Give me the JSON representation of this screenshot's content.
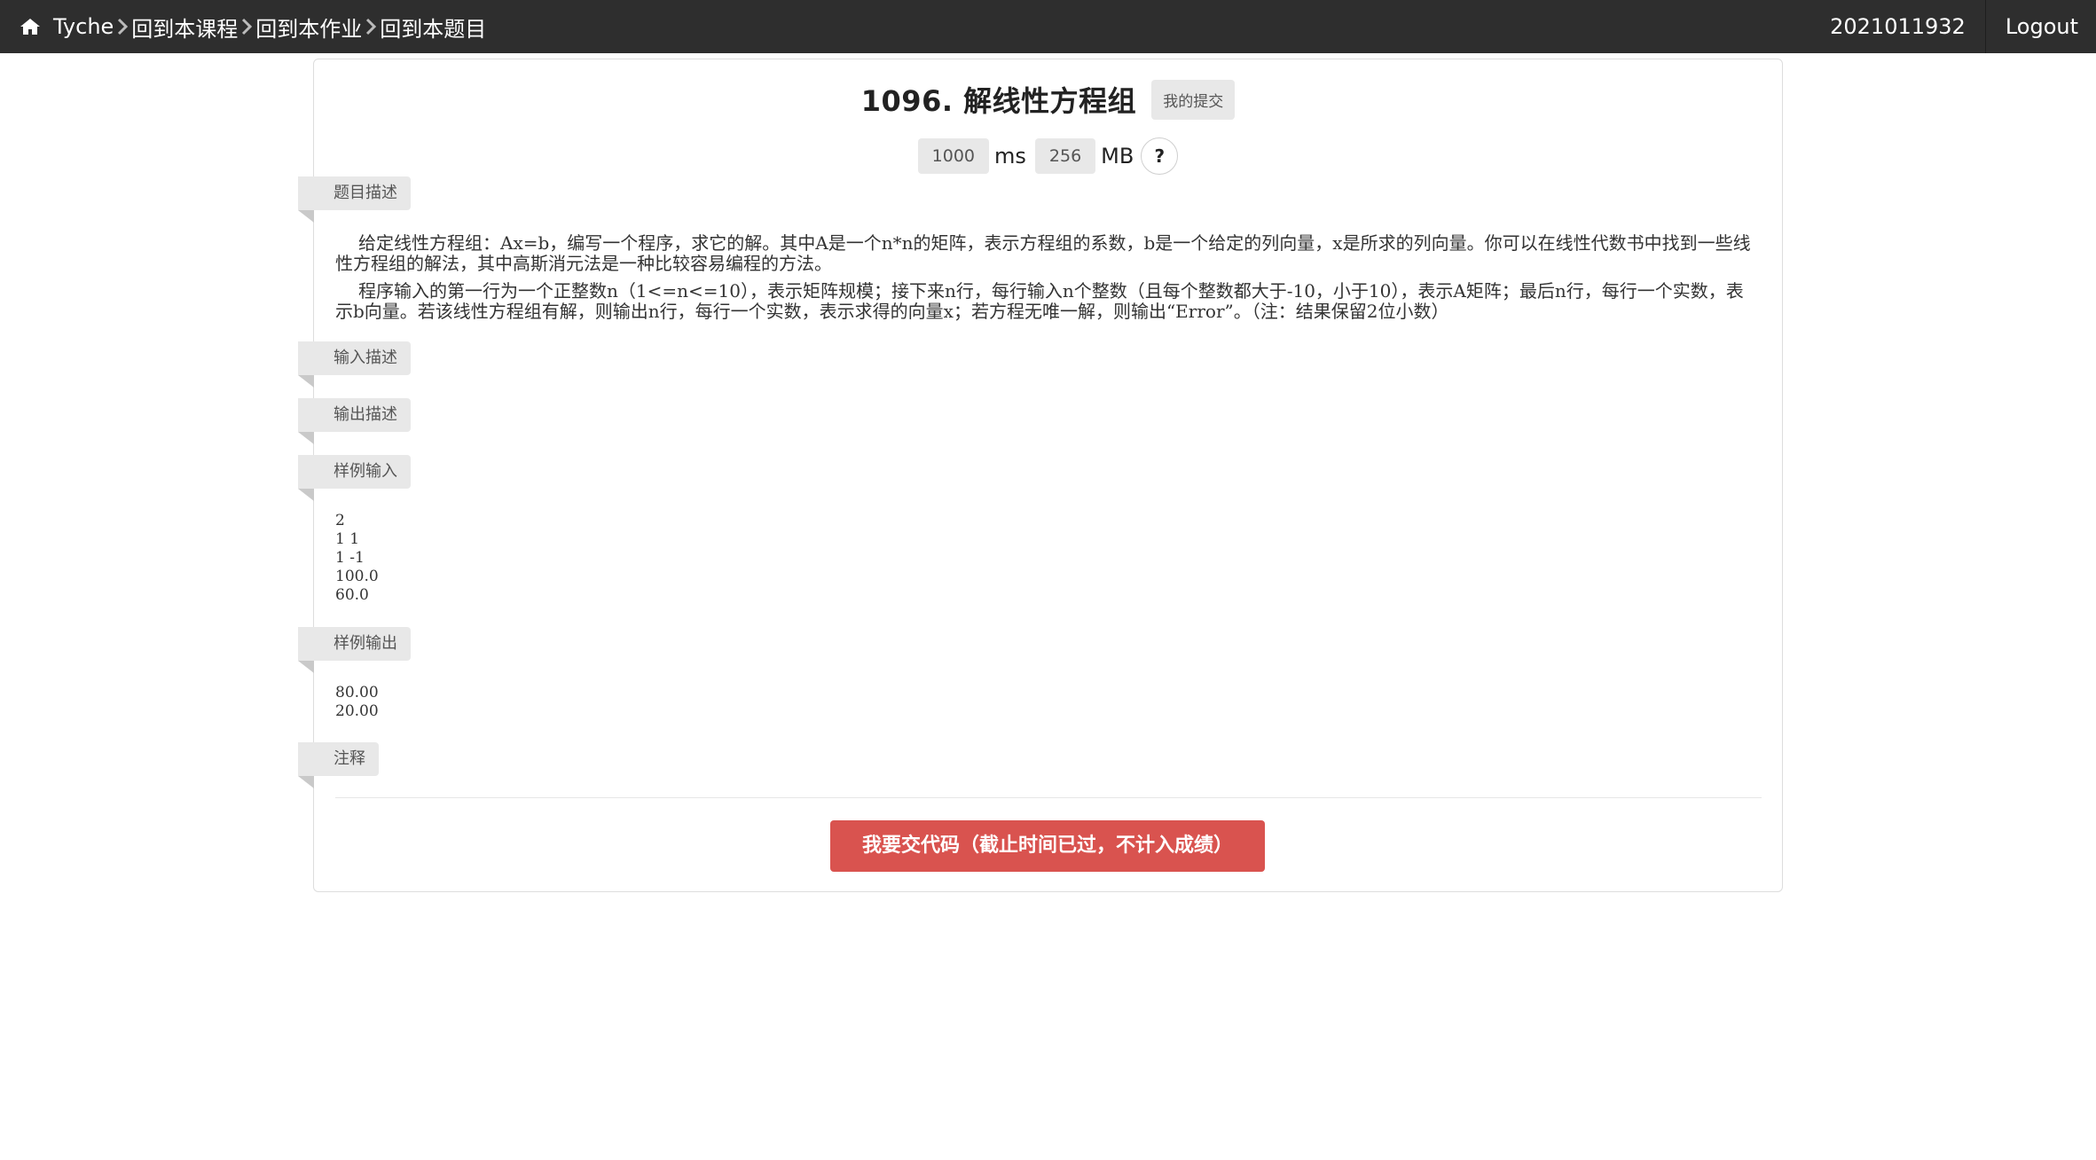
{
  "nav": {
    "home_icon": "home-icon",
    "brand": "Tyche",
    "crumbs": [
      "回到本课程",
      "回到本作业",
      "回到本题目"
    ],
    "user": "2021011932",
    "logout": "Logout"
  },
  "problem": {
    "title": "1096. 解线性方程组",
    "my_submissions": "我的提交",
    "time_limit": "1000",
    "time_unit": "ms",
    "memory_limit": "256",
    "memory_unit": "MB",
    "help": "?"
  },
  "sections": {
    "description_label": "题目描述",
    "description_p1": "给定线性方程组：Ax=b，编写一个程序，求它的解。其中A是一个n*n的矩阵，表示方程组的系数，b是一个给定的列向量，x是所求的列向量。你可以在线性代数书中找到一些线性方程组的解法，其中高斯消元法是一种比较容易编程的方法。",
    "description_p2": "程序输入的第一行为一个正整数n（1<=n<=10），表示矩阵规模；接下来n行，每行输入n个整数（且每个整数都大于-10，小于10），表示A矩阵；最后n行，每行一个实数，表示b向量。若该线性方程组有解，则输出n行，每行一个实数，表示求得的向量x；若方程无唯一解，则输出“Error”。（注：结果保留2位小数）",
    "input_label": "输入描述",
    "output_label": "输出描述",
    "sample_input_label": "样例输入",
    "sample_input": "2\n1 1\n1 -1\n100.0\n60.0",
    "sample_output_label": "样例输出",
    "sample_output": "80.00\n20.00",
    "notes_label": "注释"
  },
  "submit_button": "我要交代码（截止时间已过，不计入成绩）"
}
